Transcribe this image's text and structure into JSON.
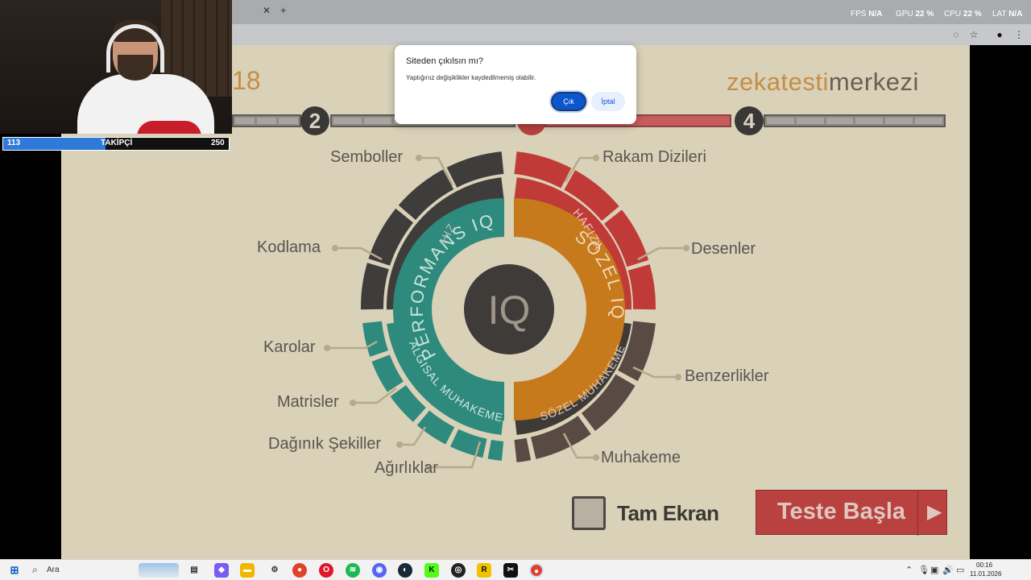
{
  "overlay": {
    "fps_label": "FPS",
    "fps_value": "N/A",
    "gpu_label": "GPU",
    "gpu_value": "22 %",
    "cpu_label": "CPU",
    "cpu_value": "22 %",
    "lat_label": "LAT",
    "lat_value": "N/A"
  },
  "follower_goal": {
    "current": "113",
    "label": "TAKİPÇİ",
    "goal": "250",
    "progress_fraction": 0.452
  },
  "page": {
    "logo_part1": "zekatesti",
    "logo_part2": "merkezi",
    "number_partial": "18",
    "steps": [
      "2",
      "4"
    ],
    "wheel": {
      "center": "IQ",
      "left_inner": "PERFORMANS IQ",
      "right_inner": "SÖZEL IQ",
      "arc_hiz": "HIZ",
      "arc_hafiza": "HAFIZA",
      "arc_algisal": "ALGISAL MUHAKEME",
      "arc_sozel": "SÖZEL MUHAKEME",
      "labels_left": [
        "Semboller",
        "Kodlama",
        "Karolar",
        "Matrisler",
        "Dağınık Şekiller",
        "Ağırlıklar"
      ],
      "labels_right": [
        "Rakam Dizileri",
        "Desenler",
        "Benzerlikler",
        "Muhakeme"
      ]
    },
    "fullscreen_label": "Tam Ekran",
    "start_button": "Teste Başla",
    "colors": {
      "dark": "#3f3d3b",
      "red": "#c03a38",
      "orange": "#c77a1c",
      "teal": "#2e8a7c",
      "brown": "#5a4a44"
    }
  },
  "dialog": {
    "title": "Siteden çıkılsın mı?",
    "message": "Yaptığınız değişiklikler kaydedilmemiş olabilir.",
    "leave_button": "Çık",
    "cancel_button": "İptal"
  },
  "taskbar": {
    "search_placeholder": "Ara",
    "time": "00:16",
    "date": "11.01.2026"
  }
}
